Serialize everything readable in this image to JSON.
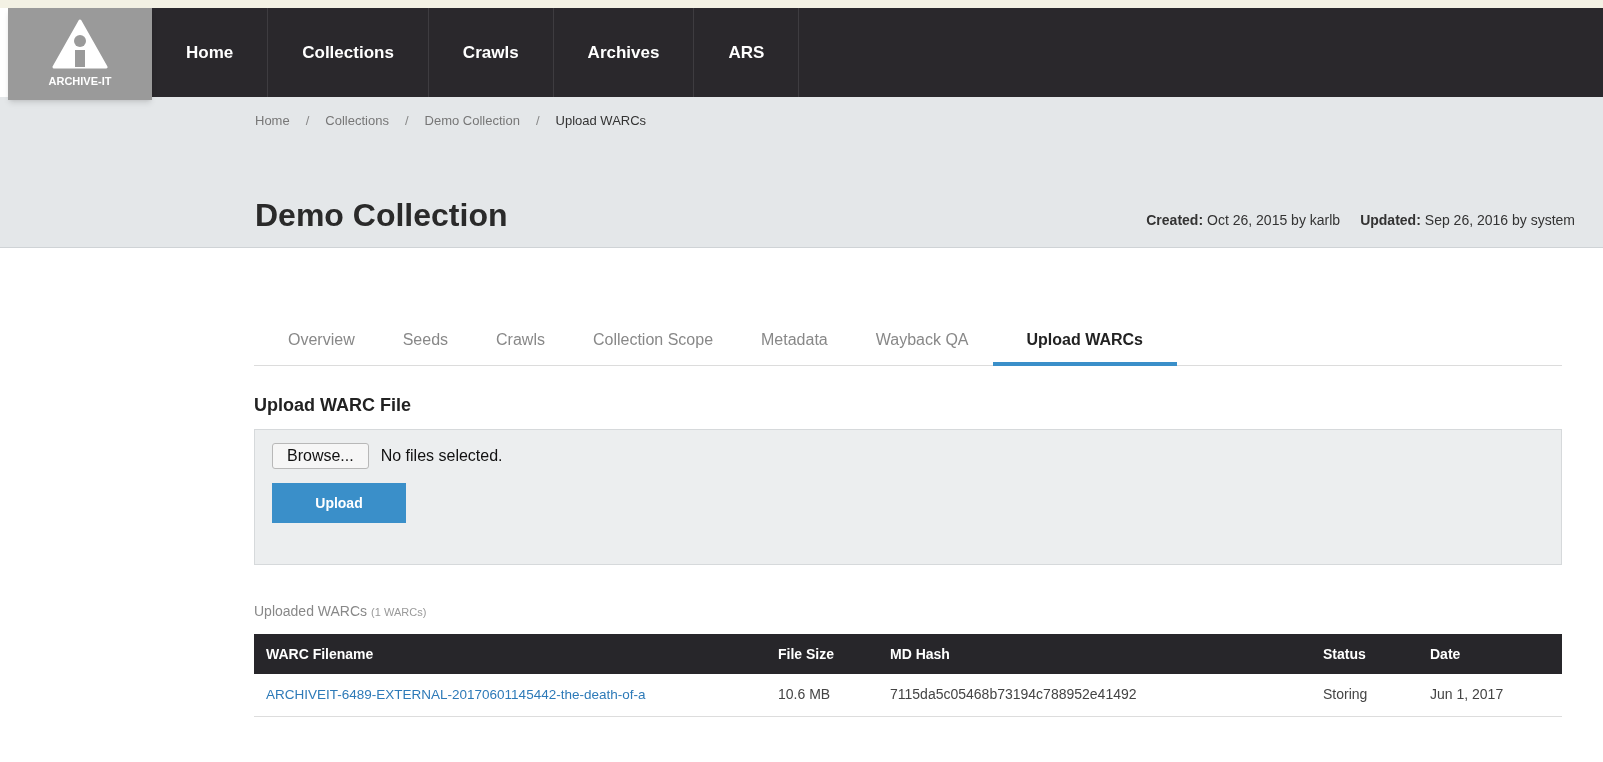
{
  "logo": {
    "text": "ARCHIVE-IT"
  },
  "nav": [
    {
      "label": "Home"
    },
    {
      "label": "Collections"
    },
    {
      "label": "Crawls"
    },
    {
      "label": "Archives"
    },
    {
      "label": "ARS"
    }
  ],
  "breadcrumb": [
    {
      "label": "Home",
      "current": false
    },
    {
      "label": "Collections",
      "current": false
    },
    {
      "label": "Demo Collection",
      "current": false
    },
    {
      "label": "Upload WARCs",
      "current": true
    }
  ],
  "breadcrumb_separator": "/",
  "title": "Demo Collection",
  "meta": [
    {
      "label": "Created:",
      "value": "Oct 26, 2015 by karlb"
    },
    {
      "label": "Updated:",
      "value": "Sep 26, 2016 by system"
    }
  ],
  "tabs": [
    {
      "label": "Overview",
      "selected": false
    },
    {
      "label": "Seeds",
      "selected": false
    },
    {
      "label": "Crawls",
      "selected": false
    },
    {
      "label": "Collection Scope",
      "selected": false
    },
    {
      "label": "Metadata",
      "selected": false
    },
    {
      "label": "Wayback QA",
      "selected": false
    },
    {
      "label": "Upload WARCs",
      "selected": true
    }
  ],
  "upload": {
    "heading": "Upload WARC File",
    "browse_button": "Browse...",
    "file_status": "No files selected.",
    "upload_button": "Upload"
  },
  "uploaded": {
    "heading": "Uploaded WARCs",
    "count": "(1 WARCs)"
  },
  "table": {
    "columns": [
      "WARC Filename",
      "File Size",
      "MD Hash",
      "Status",
      "Date"
    ],
    "rows": [
      {
        "filename": "ARCHIVEIT-6489-EXTERNAL-20170601145442-the-death-of-a",
        "size": "10.6 MB",
        "hash": "7115da5c05468b73194c788952e41492",
        "status": "Storing",
        "date": "Jun 1, 2017"
      }
    ]
  }
}
